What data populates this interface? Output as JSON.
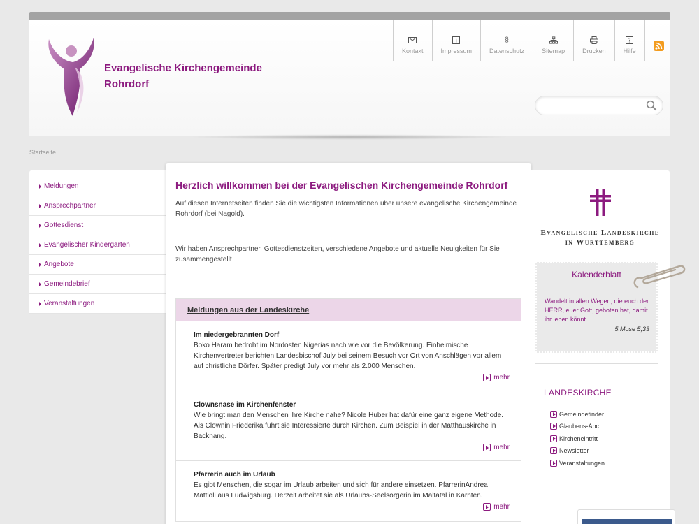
{
  "site": {
    "title_line1": "Evangelische Kirchengemeinde",
    "title_line2": "Rohrdorf"
  },
  "service_nav": [
    {
      "label": "Kontakt",
      "icon": "envelope-icon"
    },
    {
      "label": "Impressum",
      "icon": "info-icon"
    },
    {
      "label": "Datenschutz",
      "icon": "paragraph-icon"
    },
    {
      "label": "Sitemap",
      "icon": "sitemap-icon"
    },
    {
      "label": "Drucken",
      "icon": "printer-icon"
    },
    {
      "label": "Hilfe",
      "icon": "help-icon"
    }
  ],
  "search": {
    "placeholder": "",
    "icon": "search-icon"
  },
  "breadcrumb": "Startseite",
  "sidebar": {
    "items": [
      {
        "label": "Meldungen"
      },
      {
        "label": "Ansprechpartner"
      },
      {
        "label": "Gottesdienst"
      },
      {
        "label": "Evangelischer Kindergarten"
      },
      {
        "label": "Angebote"
      },
      {
        "label": "Gemeindebrief"
      },
      {
        "label": "Veranstaltungen"
      }
    ]
  },
  "main": {
    "heading": "Herzlich willkommen bei der Evangelischen Kirchengemeinde Rohrdorf",
    "intro1": "Auf diesen Internetseiten finden Sie die wichtigsten Informationen über unsere evangelische Kirchengemeinde Rohrdorf (bei Nagold).",
    "intro2": "Wir haben Ansprechpartner, Gottesdienstzeiten, verschiedene Angebote und aktuelle Neuigkeiten für Sie zusammengestellt",
    "news": {
      "heading": "Meldungen aus der Landeskirche",
      "more_label": "mehr",
      "items": [
        {
          "title": "Im niedergebrannten Dorf",
          "text": "Boko Haram bedroht im Nordosten Nigerias nach wie vor die Bevölkerung. Einheimische Kirchenvertreter berichten Landesbischof July bei seinem Besuch vor Ort von Anschlägen vor allem auf christliche Dörfer. Später predigt July vor mehr als 2.000 Menschen."
        },
        {
          "title": "Clownsnase im Kirchenfenster",
          "text": "Wie bringt man den Menschen ihre Kirche nahe? Nicole Huber hat dafür eine ganz eigene Methode. Als Clownin Friederika führt sie Interessierte durch Kirchen. Zum Beispiel in der Matthäuskirche in Backnang."
        },
        {
          "title": "Pfarrerin auch im Urlaub",
          "text": "Es gibt Menschen, die sogar im Urlaub arbeiten und sich für andere einsetzen. PfarrerinAndrea Mattioli aus Ludwigsburg. Derzeit arbeitet sie als Urlaubs-Seelsorgerin im Maltatal in Kärnten."
        }
      ]
    }
  },
  "right": {
    "landeskirche_logo": {
      "line1": "Evangelische Landeskirche",
      "line2": "in Württemberg"
    },
    "calendar": {
      "title": "Kalenderblatt",
      "text": "Wandelt in allen Wegen, die euch der HERR, euer Gott, geboten hat, damit ihr leben könnt.",
      "reference": "5.Mose 5,33"
    },
    "landeskirche": {
      "heading": "LANDESKIRCHE",
      "links": [
        {
          "label": "Gemeindefinder"
        },
        {
          "label": "Glaubens-Abc"
        },
        {
          "label": "Kircheneintritt"
        },
        {
          "label": "Newsletter"
        },
        {
          "label": "Veranstaltungen"
        }
      ]
    }
  },
  "colors": {
    "brand": "#8c1a7f",
    "news_header_bg": "#ecd6e8",
    "rss": "#f39c1f"
  }
}
